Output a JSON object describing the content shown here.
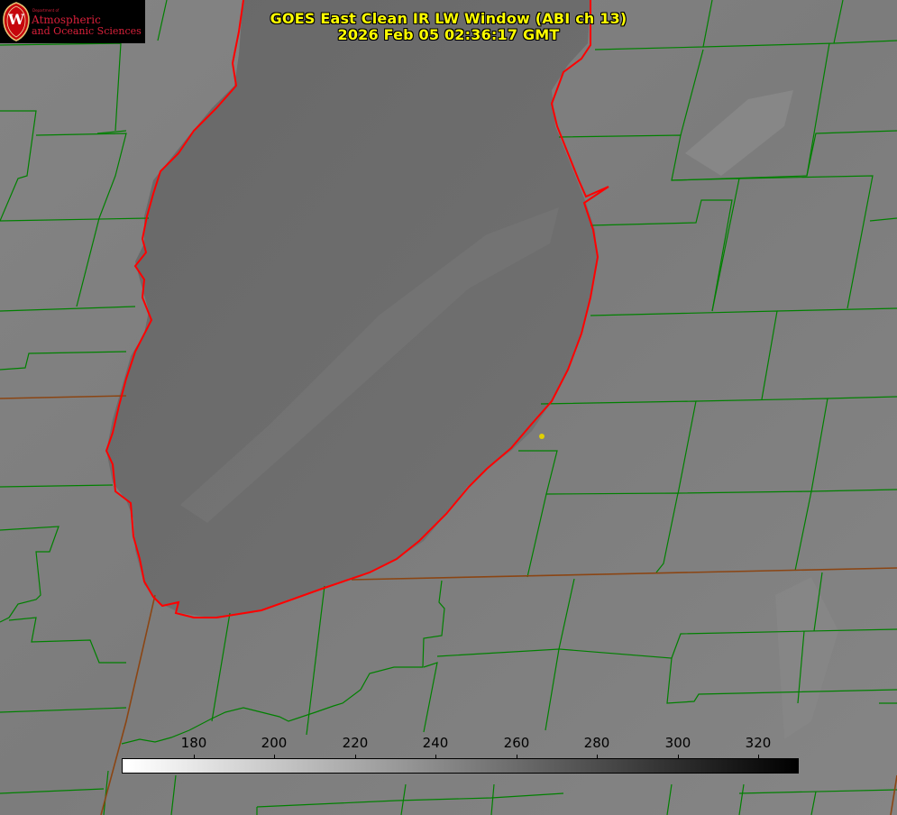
{
  "logo": {
    "department": "Department of",
    "line1": "Atmospheric",
    "line2": "and Oceanic Sciences",
    "seal_letter": "W",
    "seal_color": "#c5050c"
  },
  "title": {
    "line1": "GOES East Clean IR LW Window (ABI ch 13)",
    "line2": "2026 Feb 05 02:36:17 GMT",
    "color": "#ffff00"
  },
  "colorbar": {
    "ticks": [
      "180",
      "200",
      "220",
      "240",
      "260",
      "280",
      "300",
      "320"
    ],
    "min_color": "#ffffff",
    "max_color": "#000000"
  },
  "map": {
    "background_color": "#7d7d7d",
    "lake_color": "#666666",
    "county_line_color": "#008000",
    "shoreline_color": "#ff0000",
    "state_line_color": "#8b4513",
    "marker_color": "#e0d000"
  }
}
